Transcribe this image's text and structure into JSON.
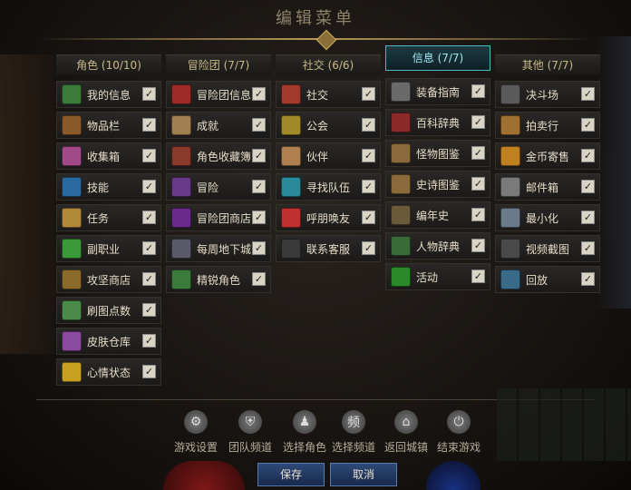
{
  "window": {
    "title": "编辑菜单"
  },
  "columns": [
    {
      "header": "角色 (10/10)",
      "active": false,
      "items": [
        {
          "label": "我的信息",
          "icon": "person-icon",
          "color": "#3c7a3a"
        },
        {
          "label": "物品栏",
          "icon": "bag-icon",
          "color": "#8a5a2a"
        },
        {
          "label": "收集箱",
          "icon": "box-icon",
          "color": "#a04a8a"
        },
        {
          "label": "技能",
          "icon": "spark-icon",
          "color": "#2a6aa0"
        },
        {
          "label": "任务",
          "icon": "scroll-icon",
          "color": "#b08a3a"
        },
        {
          "label": "副职业",
          "icon": "potion-icon",
          "color": "#3a9a3a"
        },
        {
          "label": "攻坚商店",
          "icon": "chest-icon",
          "color": "#8a6a2a"
        },
        {
          "label": "刷图点数",
          "icon": "face-icon",
          "color": "#4a8a4a"
        },
        {
          "label": "皮肤仓库",
          "icon": "brush-icon",
          "color": "#8a4aa0"
        },
        {
          "label": "心情状态",
          "icon": "smile-icon",
          "color": "#c8a020"
        }
      ]
    },
    {
      "header": "冒险团 (7/7)",
      "active": false,
      "items": [
        {
          "label": "冒险团信息",
          "icon": "banner-icon",
          "color": "#a02a2a"
        },
        {
          "label": "成就",
          "icon": "scroll-icon",
          "color": "#a08050"
        },
        {
          "label": "角色收藏簿",
          "icon": "book-icon",
          "color": "#8a3a2a"
        },
        {
          "label": "冒险",
          "icon": "map-icon",
          "color": "#6a3a8a"
        },
        {
          "label": "冒险团商店",
          "icon": "shop-icon",
          "color": "#6a2a8a"
        },
        {
          "label": "每周地下城",
          "icon": "gate-icon",
          "color": "#5a5a6a"
        },
        {
          "label": "精锐角色",
          "icon": "person-icon",
          "color": "#3a7a3a"
        }
      ]
    },
    {
      "header": "社交 (6/6)",
      "active": false,
      "items": [
        {
          "label": "社交",
          "icon": "shield-icon",
          "color": "#a03a2a"
        },
        {
          "label": "公会",
          "icon": "eagle-icon",
          "color": "#a08a2a"
        },
        {
          "label": "伙伴",
          "icon": "handshake-icon",
          "color": "#b08050"
        },
        {
          "label": "寻找队伍",
          "icon": "group-icon",
          "color": "#2a8a9a"
        },
        {
          "label": "呼朋唤友",
          "icon": "friend-icon",
          "color": "#c03030"
        },
        {
          "label": "联系客服",
          "icon": "headset-icon",
          "color": "#3a3a3a"
        }
      ]
    },
    {
      "header": "信息 (7/7)",
      "active": true,
      "items": [
        {
          "label": "装备指南",
          "icon": "equip-icon",
          "color": "#6a6a6a"
        },
        {
          "label": "百科辞典",
          "icon": "book-icon",
          "color": "#8a2a2a"
        },
        {
          "label": "怪物图鉴",
          "icon": "book-icon",
          "color": "#8a6a3a"
        },
        {
          "label": "史诗图鉴",
          "icon": "book-icon",
          "color": "#8a6a3a"
        },
        {
          "label": "编年史",
          "icon": "gear-icon",
          "color": "#6a5a3a"
        },
        {
          "label": "人物辞典",
          "icon": "person-icon",
          "color": "#3a6a3a"
        },
        {
          "label": "活动",
          "icon": "calendar-icon",
          "color": "#2a8a2a"
        }
      ]
    },
    {
      "header": "其他 (7/7)",
      "active": false,
      "items": [
        {
          "label": "决斗场",
          "icon": "swords-icon",
          "color": "#5a5a5a"
        },
        {
          "label": "拍卖行",
          "icon": "hammer-icon",
          "color": "#a07030"
        },
        {
          "label": "金币寄售",
          "icon": "coins-icon",
          "color": "#c08020"
        },
        {
          "label": "邮件箱",
          "icon": "mail-icon",
          "color": "#7a7a7a"
        },
        {
          "label": "最小化",
          "icon": "minimize-icon",
          "color": "#6a7a8a"
        },
        {
          "label": "视频截图",
          "icon": "camera-icon",
          "color": "#4a4a4a"
        },
        {
          "label": "回放",
          "icon": "replay-icon",
          "color": "#3a6a8a"
        }
      ]
    }
  ],
  "checkbox_mark": "✓",
  "system_buttons": [
    {
      "label": "游戏设置",
      "icon": "gear-icon",
      "glyph": "⚙"
    },
    {
      "label": "团队频道",
      "icon": "shield-icon",
      "glyph": "⛨"
    },
    {
      "label": "选择角色",
      "icon": "person-icon",
      "glyph": "♟"
    },
    {
      "label": "选择频道",
      "icon": "channel-icon",
      "glyph": "频"
    },
    {
      "label": "返回城镇",
      "icon": "home-icon",
      "glyph": "⌂"
    },
    {
      "label": "结束游戏",
      "icon": "power-icon",
      "glyph": "⏻"
    }
  ],
  "footer": {
    "save": "保存",
    "cancel": "取消"
  }
}
